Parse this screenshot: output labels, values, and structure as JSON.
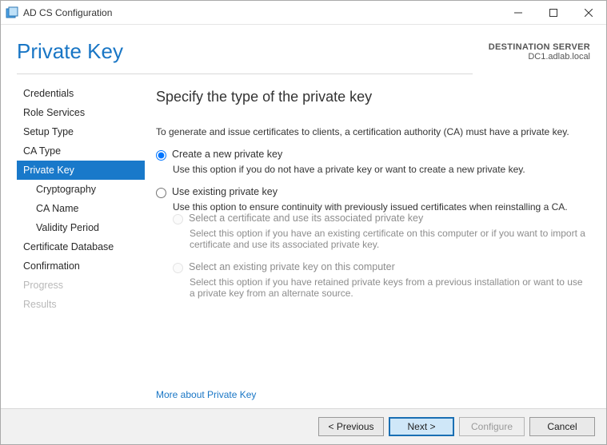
{
  "window": {
    "title": "AD CS Configuration"
  },
  "header": {
    "page_title": "Private Key",
    "destination_label": "DESTINATION SERVER",
    "destination_value": "DC1.adlab.local"
  },
  "sidebar": {
    "items": [
      {
        "label": "Credentials",
        "selected": false,
        "disabled": false,
        "sub": false
      },
      {
        "label": "Role Services",
        "selected": false,
        "disabled": false,
        "sub": false
      },
      {
        "label": "Setup Type",
        "selected": false,
        "disabled": false,
        "sub": false
      },
      {
        "label": "CA Type",
        "selected": false,
        "disabled": false,
        "sub": false
      },
      {
        "label": "Private Key",
        "selected": true,
        "disabled": false,
        "sub": false
      },
      {
        "label": "Cryptography",
        "selected": false,
        "disabled": false,
        "sub": true
      },
      {
        "label": "CA Name",
        "selected": false,
        "disabled": false,
        "sub": true
      },
      {
        "label": "Validity Period",
        "selected": false,
        "disabled": false,
        "sub": true
      },
      {
        "label": "Certificate Database",
        "selected": false,
        "disabled": false,
        "sub": false
      },
      {
        "label": "Confirmation",
        "selected": false,
        "disabled": false,
        "sub": false
      },
      {
        "label": "Progress",
        "selected": false,
        "disabled": true,
        "sub": false
      },
      {
        "label": "Results",
        "selected": false,
        "disabled": true,
        "sub": false
      }
    ]
  },
  "content": {
    "heading": "Specify the type of the private key",
    "intro": "To generate and issue certificates to clients, a certification authority (CA) must have a private key.",
    "option_new": {
      "label": "Create a new private key",
      "desc": "Use this option if you do not have a private key or want to create a new private key.",
      "checked": true
    },
    "option_existing": {
      "label": "Use existing private key",
      "desc": "Use this option to ensure continuity with previously issued certificates when reinstalling a CA.",
      "checked": false,
      "sub_cert": {
        "label": "Select a certificate and use its associated private key",
        "desc": "Select this option if you have an existing certificate on this computer or if you want to import a certificate and use its associated private key."
      },
      "sub_key": {
        "label": "Select an existing private key on this computer",
        "desc": "Select this option if you have retained private keys from a previous installation or want to use a private key from an alternate source."
      }
    },
    "more_link": "More about Private Key"
  },
  "footer": {
    "previous": "< Previous",
    "next": "Next >",
    "configure": "Configure",
    "cancel": "Cancel"
  }
}
